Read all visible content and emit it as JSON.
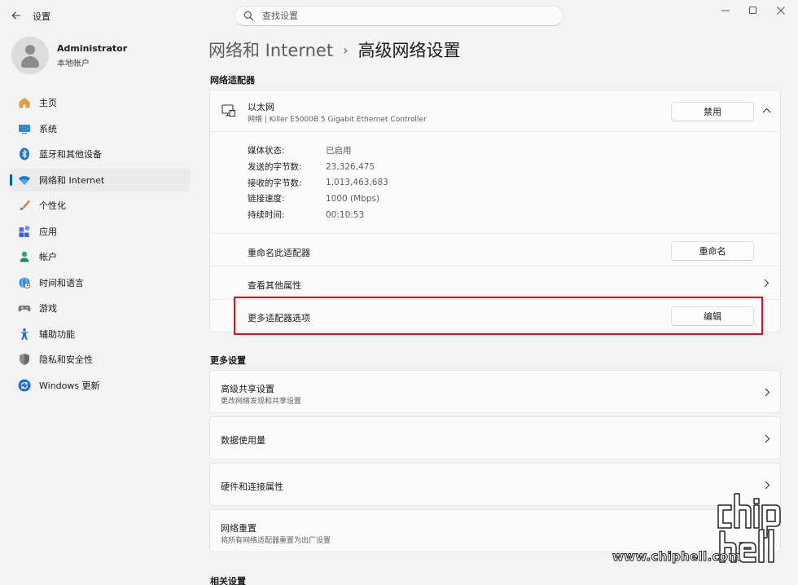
{
  "window": {
    "title": "设置",
    "controls": [
      "minimize",
      "maximize",
      "close"
    ]
  },
  "search": {
    "placeholder": "查找设置"
  },
  "profile": {
    "name": "Administrator",
    "account_type": "本地帐户"
  },
  "sidebar": {
    "items": [
      {
        "label": "主页",
        "icon": "home-icon",
        "active": false
      },
      {
        "label": "系统",
        "icon": "system-icon",
        "active": false
      },
      {
        "label": "蓝牙和其他设备",
        "icon": "bluetooth-icon",
        "active": false
      },
      {
        "label": "网络和 Internet",
        "icon": "wifi-icon",
        "active": true
      },
      {
        "label": "个性化",
        "icon": "brush-icon",
        "active": false
      },
      {
        "label": "应用",
        "icon": "apps-icon",
        "active": false
      },
      {
        "label": "帐户",
        "icon": "account-icon",
        "active": false
      },
      {
        "label": "时间和语言",
        "icon": "globe-clock-icon",
        "active": false
      },
      {
        "label": "游戏",
        "icon": "gamepad-icon",
        "active": false
      },
      {
        "label": "辅助功能",
        "icon": "accessibility-icon",
        "active": false
      },
      {
        "label": "隐私和安全性",
        "icon": "shield-icon",
        "active": false
      },
      {
        "label": "Windows 更新",
        "icon": "update-icon",
        "active": false
      }
    ]
  },
  "breadcrumb": {
    "parent": "网络和 Internet",
    "separator": "›",
    "current": "高级网络设置"
  },
  "network_adapters": {
    "section_title": "网络适配器",
    "adapter": {
      "name": "以太网",
      "description": "网络 | Killer E5000B 5 Gigabit Ethernet Controller",
      "disable_label": "禁用",
      "properties": [
        {
          "label": "媒体状态:",
          "value": "已启用"
        },
        {
          "label": "发送的字节数:",
          "value": "23,326,475"
        },
        {
          "label": "接收的字节数:",
          "value": "1,013,463,683"
        },
        {
          "label": "链接速度:",
          "value": "1000 (Mbps)"
        },
        {
          "label": "持续时间:",
          "value": "00:10:53"
        }
      ],
      "rename_row": {
        "label": "重命名此适配器",
        "button": "重命名"
      },
      "more_props_row": {
        "label": "查看其他属性"
      },
      "more_options_row": {
        "label": "更多适配器选项",
        "button": "编辑"
      }
    }
  },
  "more_settings": {
    "section_title": "更多设置",
    "items": [
      {
        "title": "高级共享设置",
        "subtitle": "更改网络发现和共享设置"
      },
      {
        "title": "数据使用量",
        "subtitle": ""
      },
      {
        "title": "硬件和连接属性",
        "subtitle": ""
      },
      {
        "title": "网络重置",
        "subtitle": "将所有网络适配器重置为出厂设置"
      }
    ]
  },
  "related_settings": {
    "section_title": "相关设置"
  },
  "watermark": {
    "text": "www.chiphell.com",
    "logo_text": "chip hell"
  },
  "colors": {
    "accent": "#005fb8",
    "highlight_box": "#d9121d"
  }
}
